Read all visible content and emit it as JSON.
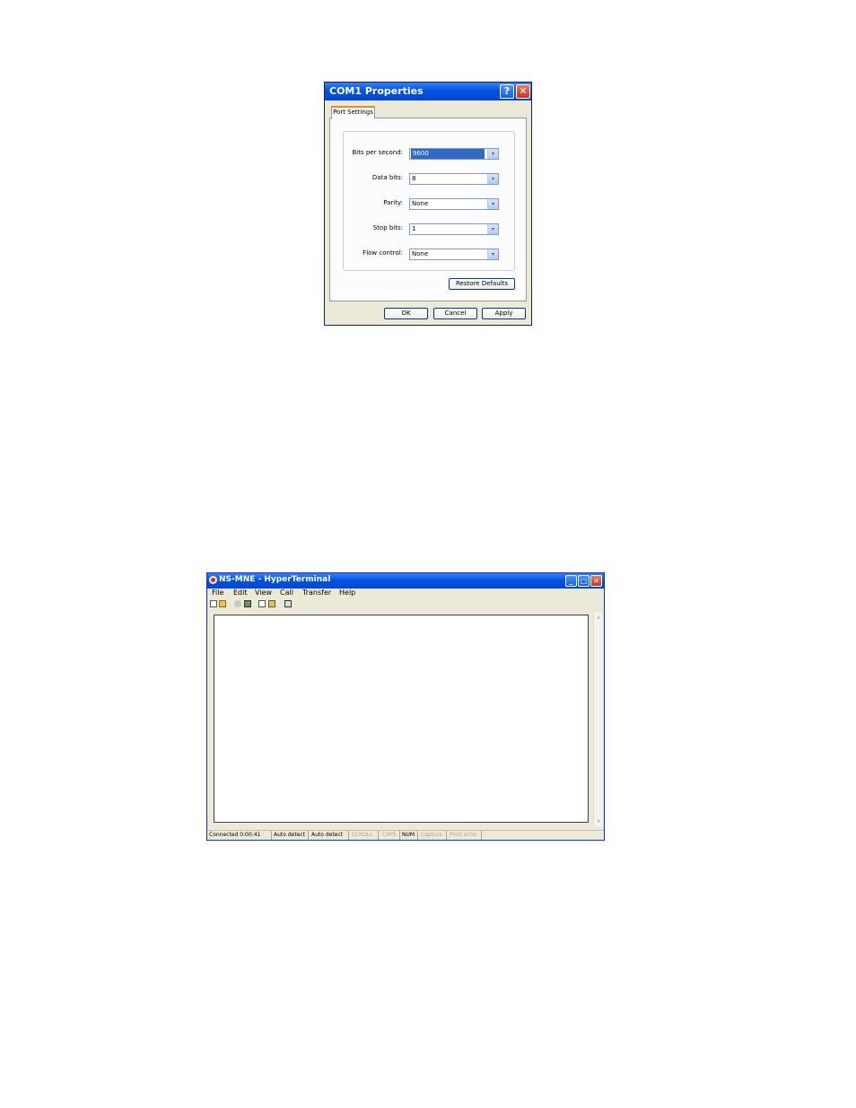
{
  "com1_dialog": {
    "title": "COM1 Properties",
    "help_label": "?",
    "close_label": "✕",
    "tab_label": "Port Settings",
    "fields": [
      {
        "label": "Bits per second:",
        "value": "9600"
      },
      {
        "label": "Data bits:",
        "value": "8"
      },
      {
        "label": "Parity:",
        "value": "None"
      },
      {
        "label": "Stop bits:",
        "value": "1"
      },
      {
        "label": "Flow control:",
        "value": "None"
      }
    ],
    "restore_defaults_label": "Restore Defaults",
    "ok_label": "OK",
    "cancel_label": "Cancel",
    "apply_label": "Apply",
    "dropdown_arrow": "▾"
  },
  "hyperterminal": {
    "title": "NS-MNE - HyperTerminal",
    "minimize_label": "_",
    "maximize_label": "□",
    "close_label": "✕",
    "menu": [
      "File",
      "Edit",
      "View",
      "Call",
      "Transfer",
      "Help"
    ],
    "toolbar_icons": [
      "new-icon",
      "open-icon",
      "call-icon",
      "disconnect-icon",
      "send-icon",
      "receive-icon",
      "properties-icon"
    ],
    "status": {
      "connected": "Connected 0:00:41",
      "detect1": "Auto detect",
      "detect2": "Auto detect",
      "scroll": "SCROLL",
      "caps": "CAPS",
      "num": "NUM",
      "capture": "Capture",
      "print_echo": "Print echo"
    }
  },
  "colors": {
    "titlebar": "#0054e3",
    "dialog_bg": "#ece9d8",
    "selection": "#316ac5",
    "disabled_text": "#aca899"
  }
}
